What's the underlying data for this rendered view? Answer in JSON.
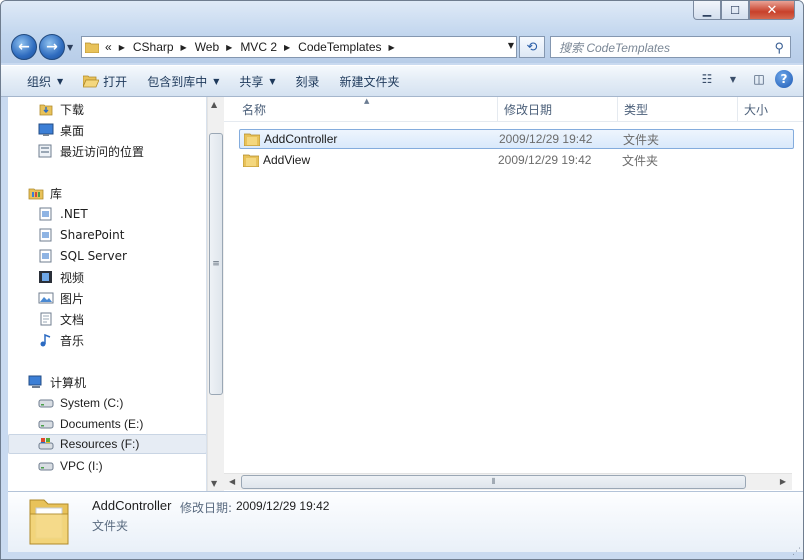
{
  "address": {
    "overflow": "«",
    "crumbs": [
      "CSharp",
      "Web",
      "MVC 2",
      "CodeTemplates"
    ]
  },
  "search": {
    "placeholder": "搜索 CodeTemplates"
  },
  "toolbar": {
    "organize": "组织",
    "open": "打开",
    "include_library": "包含到库中",
    "share": "共享",
    "burn": "刻录",
    "new_folder": "新建文件夹"
  },
  "nav": {
    "favorites": [
      {
        "label": "下载",
        "icon": "download-folder-icon"
      },
      {
        "label": "桌面",
        "icon": "desktop-icon"
      },
      {
        "label": "最近访问的位置",
        "icon": "recent-places-icon"
      }
    ],
    "libraries_label": "库",
    "libraries": [
      {
        "label": ".NET",
        "icon": "library-doc-icon"
      },
      {
        "label": "SharePoint",
        "icon": "library-doc-icon"
      },
      {
        "label": "SQL Server",
        "icon": "library-doc-icon"
      },
      {
        "label": "视频",
        "icon": "video-library-icon"
      },
      {
        "label": "图片",
        "icon": "pictures-library-icon"
      },
      {
        "label": "文档",
        "icon": "documents-library-icon"
      },
      {
        "label": "音乐",
        "icon": "music-library-icon"
      }
    ],
    "computer_label": "计算机",
    "drives": [
      {
        "label": "System (C:)",
        "icon": "drive-icon"
      },
      {
        "label": "Documents (E:)",
        "icon": "drive-icon"
      },
      {
        "label": "Resources (F:)",
        "icon": "system-drive-icon",
        "selected": true
      },
      {
        "label": "VPC (I:)",
        "icon": "drive-icon"
      }
    ]
  },
  "columns": {
    "name": "名称",
    "modified": "修改日期",
    "type": "类型",
    "size": "大小"
  },
  "files": [
    {
      "name": "AddController",
      "modified": "2009/12/29 19:42",
      "type": "文件夹",
      "selected": true
    },
    {
      "name": "AddView",
      "modified": "2009/12/29 19:42",
      "type": "文件夹",
      "selected": false
    }
  ],
  "details": {
    "name": "AddController",
    "modified_label": "修改日期:",
    "modified_value": "2009/12/29 19:42",
    "type": "文件夹"
  },
  "colors": {
    "selection_border": "#84acdd",
    "folder": "#e8c25a"
  }
}
